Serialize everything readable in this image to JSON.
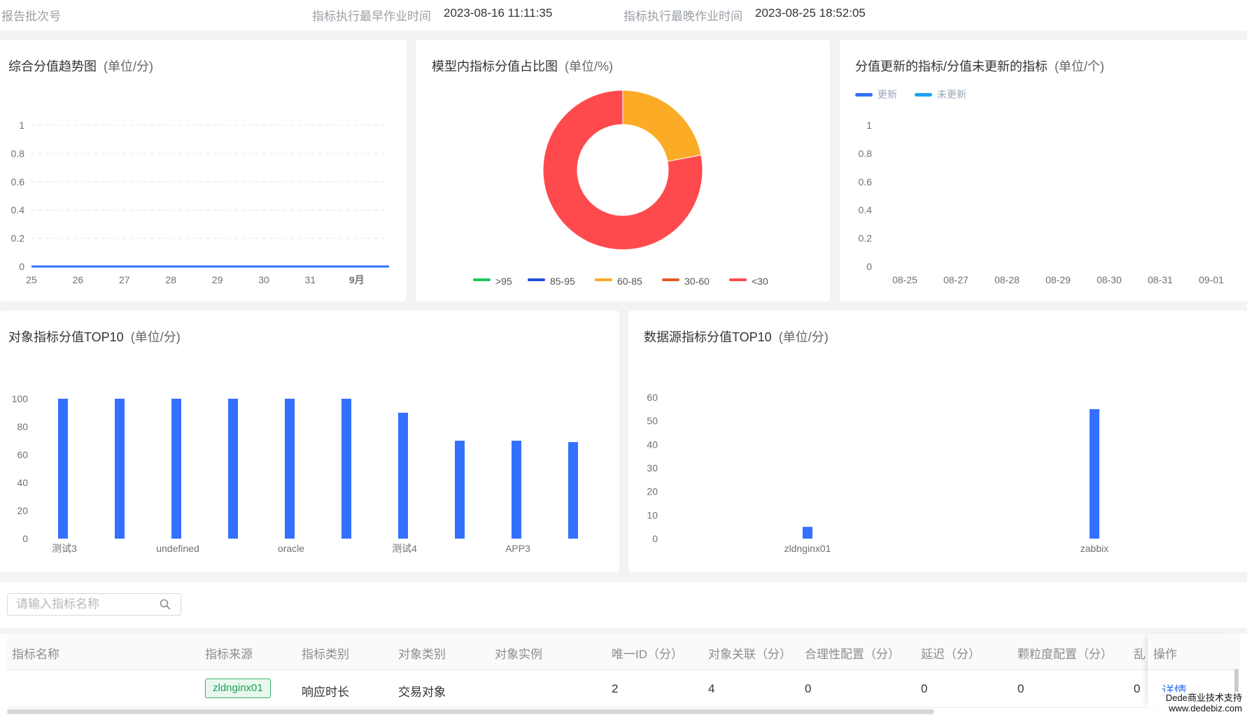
{
  "header": {
    "batch_label": "报告批次号",
    "earliest_label": "指标执行最早作业时间",
    "earliest_value": "2023-08-16 11:11:35",
    "latest_label": "指标执行最晚作业时间",
    "latest_value": "2023-08-25 18:52:05"
  },
  "cards": {
    "trend": {
      "title": "综合分值趋势图",
      "unit": "(单位/分)"
    },
    "pie": {
      "title": "模型内指标分值占比图",
      "unit": "(单位/%)"
    },
    "update": {
      "title": "分值更新的指标/分值未更新的指标",
      "unit": "(单位/个)"
    },
    "object_top": {
      "title": "对象指标分值TOP10",
      "unit": "(单位/分)"
    },
    "source_top": {
      "title": "数据源指标分值TOP10",
      "unit": "(单位/分)"
    }
  },
  "colors": {
    "primary": "#3470ff",
    "light_blue": "#1aa3f3",
    "green": "#22c55e",
    "dark_blue": "#1f4fd6",
    "orange": "#fbab25",
    "deep_orange": "#e35a25",
    "red": "#ff4a4d"
  },
  "chart_data": [
    {
      "type": "line",
      "x": [
        "25",
        "26",
        "27",
        "28",
        "29",
        "30",
        "31",
        "9月"
      ],
      "values": [
        0,
        0,
        0,
        0,
        0,
        0,
        0,
        0
      ],
      "yticks": [
        "0",
        "0.2",
        "0.4",
        "0.6",
        "0.8",
        "1"
      ],
      "ylim": [
        0,
        1
      ],
      "grid": true
    },
    {
      "type": "pie",
      "legend": [
        ">95",
        "85-95",
        "60-85",
        "30-60",
        "<30"
      ],
      "legend_placement": "bottom",
      "slices": [
        {
          "label": "60-85",
          "percent": 22
        },
        {
          "label": "<30",
          "percent": 78
        }
      ]
    },
    {
      "type": "line",
      "legend": [
        "更新",
        "未更新"
      ],
      "legend_placement": "top-left",
      "x": [
        "08-25",
        "08-27",
        "08-28",
        "08-29",
        "08-30",
        "08-31",
        "09-01"
      ],
      "yticks": [
        "0",
        "0.2",
        "0.4",
        "0.6",
        "0.8",
        "1"
      ],
      "ylim": [
        0,
        1
      ],
      "grid": false
    },
    {
      "type": "bar",
      "values": [
        100,
        100,
        100,
        100,
        100,
        100,
        90,
        70,
        70,
        69
      ],
      "xtick_labels": [
        "测试3",
        "undefined",
        "oracle",
        "测试4",
        "APP3"
      ],
      "xtick_positions": [
        0,
        2,
        4,
        6,
        8
      ],
      "yticks": [
        "0",
        "20",
        "40",
        "60",
        "80",
        "100"
      ],
      "ylim": [
        0,
        100
      ]
    },
    {
      "type": "bar",
      "categories": [
        "zldnginx01",
        "zabbix"
      ],
      "values": [
        5,
        55
      ],
      "yticks": [
        "0",
        "10",
        "20",
        "30",
        "40",
        "50",
        "60"
      ],
      "ylim": [
        0,
        60
      ]
    }
  ],
  "search": {
    "placeholder": "请输入指标名称"
  },
  "table": {
    "columns": [
      "指标名称",
      "指标来源",
      "指标类别",
      "对象类别",
      "对象实例",
      "唯一ID（分）",
      "对象关联（分）",
      "合理性配置（分）",
      "延迟（分）",
      "颗粒度配置（分）",
      "乱"
    ],
    "op_column": "操作",
    "rows": [
      {
        "name": "",
        "source": "zldnginx01",
        "category": "响应时长",
        "object_type": "交易对象",
        "instance": "",
        "unique_id": "2",
        "relation": "4",
        "reasonable": "0",
        "delay": "0",
        "granularity": "0",
        "last": "0",
        "op": "详情"
      }
    ]
  },
  "watermark": {
    "line1": "Dede商业技术支持",
    "line2": "www.dedebiz.com"
  }
}
